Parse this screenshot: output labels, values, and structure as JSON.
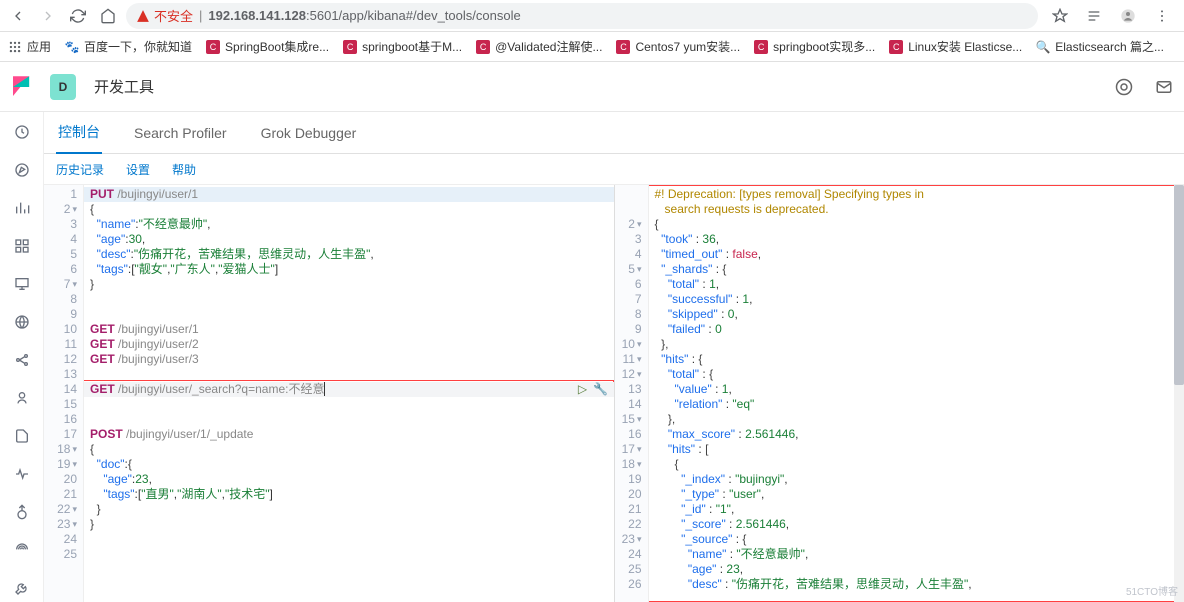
{
  "browser": {
    "insecure_label": "不安全",
    "host": "192.168.141.128",
    "port_path": ":5601/app/kibana#/dev_tools/console"
  },
  "bookmarks": {
    "apps": "应用",
    "items": [
      {
        "label": "百度一下，你就知道"
      },
      {
        "label": "SpringBoot集成re..."
      },
      {
        "label": "springboot基于M..."
      },
      {
        "label": "@Validated注解使..."
      },
      {
        "label": "Centos7 yum安装..."
      },
      {
        "label": "springboot实现多..."
      },
      {
        "label": "Linux安装 Elasticse..."
      },
      {
        "label": "Elasticsearch 篇之..."
      }
    ]
  },
  "header": {
    "space_letter": "D",
    "title": "开发工具"
  },
  "tabs": [
    {
      "label": "控制台",
      "active": true
    },
    {
      "label": "Search Profiler",
      "active": false
    },
    {
      "label": "Grok Debugger",
      "active": false
    }
  ],
  "sublinks": [
    "历史记录",
    "设置",
    "帮助"
  ],
  "editor": {
    "lines": [
      {
        "n": 1,
        "cls": "first-line",
        "html": "<span class='method'>PUT</span> <span class='path'>/bujingyi/user/1</span>"
      },
      {
        "n": 2,
        "fold": true,
        "html": "<span class='punc'>{</span>"
      },
      {
        "n": 3,
        "html": "  <span class='key'>\"name\"</span>:<span class='str'>\"不经意最帅\"</span>,"
      },
      {
        "n": 4,
        "html": "  <span class='key'>\"age\"</span>:<span class='num'>30</span>,"
      },
      {
        "n": 5,
        "html": "  <span class='key'>\"desc\"</span>:<span class='str'>\"伤痛开花，苦难结果，思维灵动，人生丰盈\"</span>,"
      },
      {
        "n": 6,
        "html": "  <span class='key'>\"tags\"</span>:[<span class='str'>\"靓女\"</span>,<span class='str'>\"广东人\"</span>,<span class='str'>\"爱猫人士\"</span>]"
      },
      {
        "n": 7,
        "fold": true,
        "html": "<span class='punc'>}</span>"
      },
      {
        "n": 8,
        "html": ""
      },
      {
        "n": 9,
        "html": ""
      },
      {
        "n": 10,
        "html": "<span class='method'>GET</span> <span class='path'>/bujingyi/user/1</span>"
      },
      {
        "n": 11,
        "html": "<span class='method'>GET</span> <span class='path'>/bujingyi/user/2</span>"
      },
      {
        "n": 12,
        "html": "<span class='method'>GET</span> <span class='path'>/bujingyi/user/3</span>"
      },
      {
        "n": 13,
        "html": ""
      },
      {
        "n": 14,
        "cls": "active-line",
        "run": true,
        "html": "<span class='method'>GET</span> <span class='path'>/bujingyi/user/_search?q=name:不经意</span><span style='border-left:1px solid #333;'></span>"
      },
      {
        "n": 15,
        "html": ""
      },
      {
        "n": 16,
        "html": ""
      },
      {
        "n": 17,
        "html": "<span class='method'>POST</span> <span class='path'>/bujingyi/user/1/_update</span>"
      },
      {
        "n": 18,
        "fold": true,
        "html": "<span class='punc'>{</span>"
      },
      {
        "n": 19,
        "fold": true,
        "html": "  <span class='key'>\"doc\"</span>:<span class='punc'>{</span>"
      },
      {
        "n": 20,
        "html": "    <span class='key'>\"age\"</span>:<span class='num'>23</span>,"
      },
      {
        "n": 21,
        "html": "    <span class='key'>\"tags\"</span>:[<span class='str'>\"直男\"</span>,<span class='str'>\"湖南人\"</span>,<span class='str'>\"技术宅\"</span>]"
      },
      {
        "n": 22,
        "fold": true,
        "html": "  <span class='punc'>}</span>"
      },
      {
        "n": 23,
        "fold": true,
        "html": "<span class='punc'>}</span>"
      },
      {
        "n": 24,
        "html": ""
      },
      {
        "n": 25,
        "html": ""
      }
    ]
  },
  "response": {
    "lines": [
      {
        "n": "",
        "html": "<span class='warn'>#! Deprecation: [types removal] Specifying types in</span>"
      },
      {
        "n": "",
        "html": "   <span class='warn'>search requests is deprecated.</span>"
      },
      {
        "n": 2,
        "fold": true,
        "html": "<span class='punc'>{</span>"
      },
      {
        "n": 3,
        "html": "  <span class='key'>\"took\"</span> : <span class='num'>36</span>,"
      },
      {
        "n": 4,
        "html": "  <span class='key'>\"timed_out\"</span> : <span class='bool'>false</span>,"
      },
      {
        "n": 5,
        "fold": true,
        "html": "  <span class='key'>\"_shards\"</span> : <span class='punc'>{</span>"
      },
      {
        "n": 6,
        "html": "    <span class='key'>\"total\"</span> : <span class='num'>1</span>,"
      },
      {
        "n": 7,
        "html": "    <span class='key'>\"successful\"</span> : <span class='num'>1</span>,"
      },
      {
        "n": 8,
        "html": "    <span class='key'>\"skipped\"</span> : <span class='num'>0</span>,"
      },
      {
        "n": 9,
        "html": "    <span class='key'>\"failed\"</span> : <span class='num'>0</span>"
      },
      {
        "n": 10,
        "fold": true,
        "html": "  <span class='punc'>},</span>"
      },
      {
        "n": 11,
        "fold": true,
        "html": "  <span class='key'>\"hits\"</span> : <span class='punc'>{</span>"
      },
      {
        "n": 12,
        "fold": true,
        "html": "    <span class='key'>\"total\"</span> : <span class='punc'>{</span>"
      },
      {
        "n": 13,
        "html": "      <span class='key'>\"value\"</span> : <span class='num'>1</span>,"
      },
      {
        "n": 14,
        "html": "      <span class='key'>\"relation\"</span> : <span class='str'>\"eq\"</span>"
      },
      {
        "n": 15,
        "fold": true,
        "html": "    <span class='punc'>},</span>"
      },
      {
        "n": 16,
        "html": "    <span class='key'>\"max_score\"</span> : <span class='num'>2.561446</span>,"
      },
      {
        "n": 17,
        "fold": true,
        "html": "    <span class='key'>\"hits\"</span> : <span class='punc'>[</span>"
      },
      {
        "n": 18,
        "fold": true,
        "html": "      <span class='punc'>{</span>"
      },
      {
        "n": 19,
        "html": "        <span class='key'>\"_index\"</span> : <span class='str'>\"bujingyi\"</span>,"
      },
      {
        "n": 20,
        "html": "        <span class='key'>\"_type\"</span> : <span class='str'>\"user\"</span>,"
      },
      {
        "n": 21,
        "html": "        <span class='key'>\"_id\"</span> : <span class='str'>\"1\"</span>,"
      },
      {
        "n": 22,
        "html": "        <span class='key'>\"_score\"</span> : <span class='num'>2.561446</span>,"
      },
      {
        "n": 23,
        "fold": true,
        "html": "        <span class='key'>\"_source\"</span> : <span class='punc'>{</span>"
      },
      {
        "n": 24,
        "html": "          <span class='key'>\"name\"</span> : <span class='str'>\"不经意最帅\"</span>,"
      },
      {
        "n": 25,
        "html": "          <span class='key'>\"age\"</span> : <span class='num'>23</span>,"
      },
      {
        "n": 26,
        "html": "          <span class='key'>\"desc\"</span> : <span class='str'>\"伤痛开花，苦难结果，思维灵动，人生丰盈\"</span>,"
      }
    ]
  },
  "watermark": "51CTO博客"
}
